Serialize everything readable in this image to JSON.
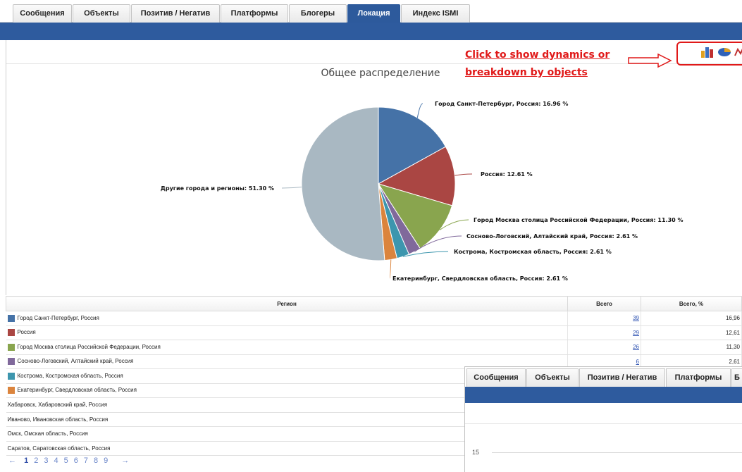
{
  "tabs": [
    "Сообщения",
    "Объекты",
    "Позитив / Негатив",
    "Платформы",
    "Блогеры",
    "Локация",
    "Индекс ISMI"
  ],
  "active_tab": "Локация",
  "annotation": {
    "line1": "Click to show dynamics or",
    "line2": "breakdown by objects"
  },
  "icons": [
    "bar-chart-icon",
    "pie-chart-icon",
    "line-chart-icon"
  ],
  "chart_data": {
    "type": "pie",
    "title": "Общее распределение",
    "slices": [
      {
        "label": "Город Санкт-Петербург, Россия: 16.96 %",
        "value": 16.96,
        "color": "#4572a7"
      },
      {
        "label": "Россия: 12.61 %",
        "value": 12.61,
        "color": "#aa4643"
      },
      {
        "label": "Город Москва столица Российской Федерации, Россия: 11.30 %",
        "value": 11.3,
        "color": "#89a54e"
      },
      {
        "label": "Сосново-Логовский, Алтайский край, Россия: 2.61 %",
        "value": 2.61,
        "color": "#80699b"
      },
      {
        "label": "Кострома, Костромская область, Россия: 2.61 %",
        "value": 2.61,
        "color": "#3d96ae"
      },
      {
        "label": "Екатеринбург, Свердловская область, Россия: 2.61 %",
        "value": 2.61,
        "color": "#db843d"
      },
      {
        "label": "Другие города и регионы: 51.30 %",
        "value": 51.3,
        "color": "#a9b8c2"
      }
    ]
  },
  "table": {
    "headers": [
      "Регион",
      "Всего",
      "Всего, %"
    ],
    "rows": [
      {
        "region": "Город Санкт-Петербург, Россия",
        "color": "#4572a7",
        "total": "39",
        "pct": "16,96"
      },
      {
        "region": "Россия",
        "color": "#aa4643",
        "total": "29",
        "pct": "12,61"
      },
      {
        "region": "Город Москва столица Российской Федерации, Россия",
        "color": "#89a54e",
        "total": "26",
        "pct": "11,30"
      },
      {
        "region": "Сосново-Логовский, Алтайский край, Россия",
        "color": "#80699b",
        "total": "6",
        "pct": "2,61"
      },
      {
        "region": "Кострома, Костромская область, Россия",
        "color": "#3d96ae",
        "total": "",
        "pct": ""
      },
      {
        "region": "Екатеринбург, Свердловская область, Россия",
        "color": "#db843d",
        "total": "",
        "pct": ""
      },
      {
        "region": "Хабаровск, Хабаровский край, Россия",
        "color": "",
        "total": "",
        "pct": ""
      },
      {
        "region": "Иваново, Ивановская область, Россия",
        "color": "",
        "total": "",
        "pct": ""
      },
      {
        "region": "Омск, Омская область, Россия",
        "color": "",
        "total": "",
        "pct": ""
      },
      {
        "region": "Саратов, Саратовская область, Россия",
        "color": "",
        "total": "",
        "pct": ""
      }
    ]
  },
  "pager": {
    "prev": "←",
    "pages": [
      "1",
      "2",
      "3",
      "4",
      "5",
      "6",
      "7",
      "8",
      "9"
    ],
    "next": "→",
    "current": "1"
  },
  "overlay": {
    "tabs": [
      "Сообщения",
      "Объекты",
      "Позитив / Негатив",
      "Платформы",
      "Б"
    ],
    "y_tick": "15"
  }
}
